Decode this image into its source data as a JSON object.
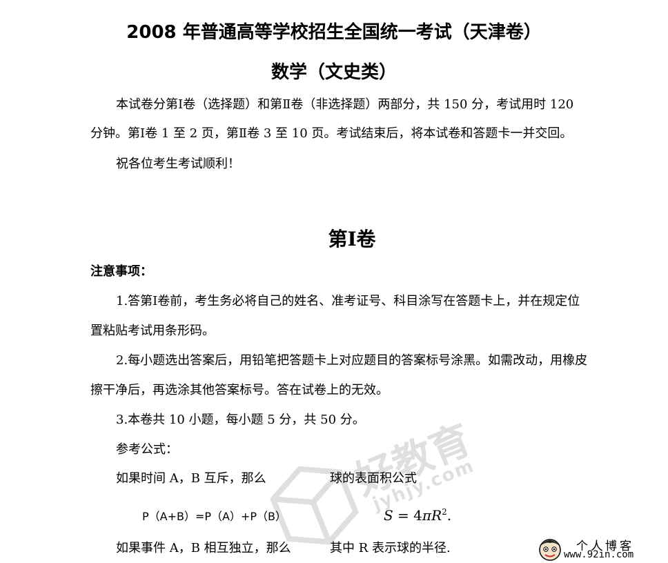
{
  "header": {
    "title": "2008 年普通高等学校招生全国统一考试（天津卷）",
    "subtitle": "数学（文史类）"
  },
  "intro": {
    "line1": "本试卷分第Ⅰ卷（选择题）和第Ⅱ卷（非选择题）两部分，共 150 分，考试用时 120",
    "line2": "分钟。第Ⅰ卷 1 至 2 页，第Ⅱ卷 3 至 10 页。考试结束后，将本试卷和答题卡一并交回。",
    "wish": "祝各位考生考试顺利！"
  },
  "section": {
    "title": "第Ⅰ卷",
    "notice_heading": "注意事项：",
    "items": [
      {
        "line1": "1.答第Ⅰ卷前，考生务必将自己的姓名、准考证号、科目涂写在答题卡上，并在规定位",
        "line2": "置粘贴考试用条形码。"
      },
      {
        "line1": "2.每小题选出答案后，用铅笔把答题卡上对应题目的答案标号涂黑。如需改动，用橡皮",
        "line2": "擦干净后，再选涂其他答案标号。答在试卷上的无效。"
      },
      {
        "line1": "3.本卷共 10 小题，每小题 5 分，共 50 分。"
      }
    ]
  },
  "formulas": {
    "heading": "参考公式：",
    "left_1": "如果时间 A，B 互斥，那么",
    "left_1_formula": "P（A+B）=P（A）+P（B）",
    "left_2": "如果事件 A，B 相互独立，那么",
    "right_1": "球的表面积公式",
    "right_formula_s": "S",
    "right_formula_eq": " = 4",
    "right_formula_pi": "π",
    "right_formula_r": "R",
    "right_formula_exp": "2",
    "right_formula_end": ".",
    "right_2": "其中 R 表示球的半径."
  },
  "watermark": {
    "brand": "好教育",
    "url": "jyhjy.com"
  },
  "badge": {
    "name": "个人博客",
    "url": "www.92in.com"
  }
}
